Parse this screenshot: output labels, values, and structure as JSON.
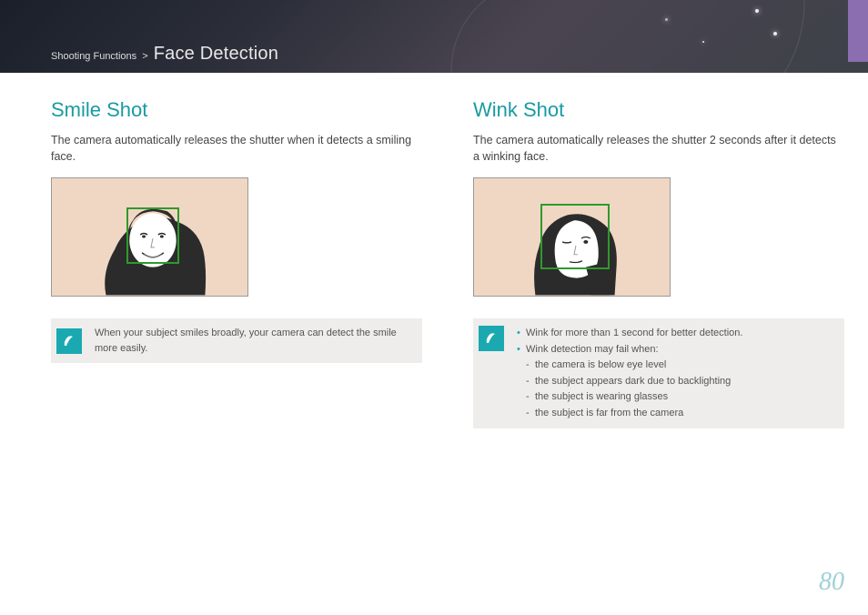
{
  "header": {
    "breadcrumb_parent": "Shooting Functions",
    "breadcrumb_sep": ">",
    "page_title": "Face Detection"
  },
  "left": {
    "heading": "Smile Shot",
    "body": "The camera automatically releases the shutter when it detects a smiling face.",
    "note": "When your subject smiles broadly, your camera can detect the smile more easily."
  },
  "right": {
    "heading": "Wink Shot",
    "body": "The camera automatically releases the shutter 2 seconds after it detects a winking face.",
    "note_bullets": {
      "b1": "Wink for more than 1 second for better detection.",
      "b2": "Wink detection may fail when:",
      "b2_sub": {
        "s1": "the camera is below eye level",
        "s2": "the subject appears dark due to backlighting",
        "s3": "the subject is wearing glasses",
        "s4": "the subject is far from the camera"
      }
    }
  },
  "page_number": "80"
}
